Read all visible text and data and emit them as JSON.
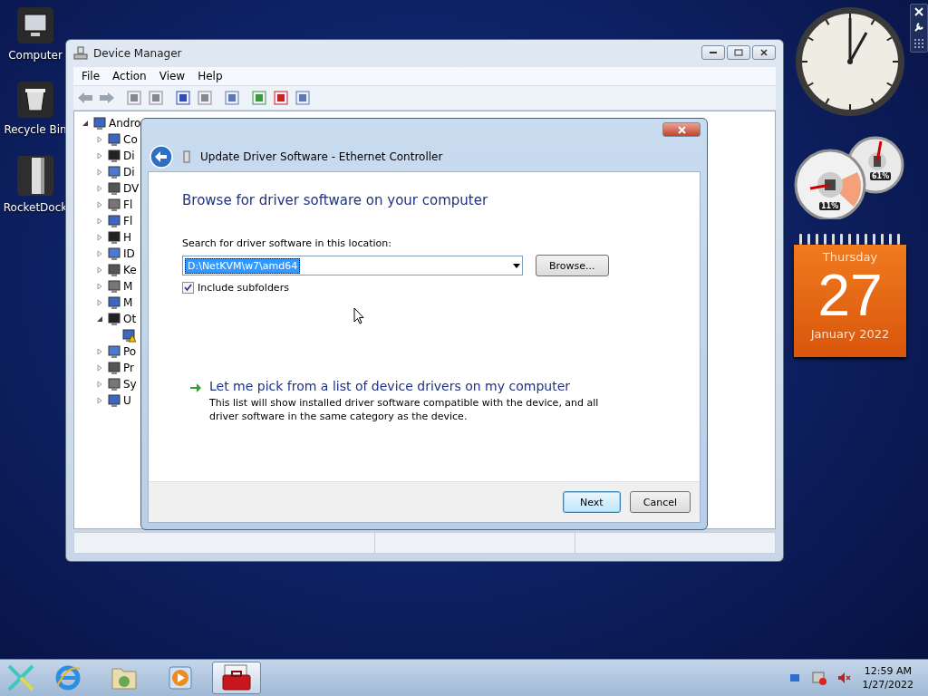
{
  "desktop_icons": [
    {
      "label": "Computer",
      "kind": "computer"
    },
    {
      "label": "Recycle Bin",
      "kind": "bin"
    },
    {
      "label": "RocketDock",
      "kind": "dock"
    }
  ],
  "device_manager": {
    "title": "Device Manager",
    "menu": [
      "File",
      "Action",
      "View",
      "Help"
    ],
    "tree": {
      "label": "Andro",
      "expanded": true,
      "warning": false,
      "children": [
        {
          "label": "Co",
          "expanded": false,
          "warning": false
        },
        {
          "label": "Di",
          "expanded": false,
          "warning": false
        },
        {
          "label": "Di",
          "expanded": false,
          "warning": false
        },
        {
          "label": "DV",
          "expanded": false,
          "warning": false
        },
        {
          "label": "Fl",
          "expanded": false,
          "warning": false
        },
        {
          "label": "Fl",
          "expanded": false,
          "warning": false
        },
        {
          "label": "H",
          "expanded": false,
          "warning": false
        },
        {
          "label": "ID",
          "expanded": false,
          "warning": false
        },
        {
          "label": "Ke",
          "expanded": false,
          "warning": false
        },
        {
          "label": "M",
          "expanded": false,
          "warning": false
        },
        {
          "label": "M",
          "expanded": false,
          "warning": false
        },
        {
          "label": "Ot",
          "expanded": true,
          "warning": false,
          "children": [
            {
              "warning": true
            }
          ]
        },
        {
          "label": "Po",
          "expanded": false,
          "warning": false
        },
        {
          "label": "Pr",
          "expanded": false,
          "warning": false
        },
        {
          "label": "Sy",
          "expanded": false,
          "warning": false
        },
        {
          "label": "U",
          "expanded": false,
          "warning": false
        }
      ]
    }
  },
  "dialog": {
    "title": "Update Driver Software - Ethernet Controller",
    "heading": "Browse for driver software on your computer",
    "location_label": "Search for driver software in this location:",
    "location_value": "D:\\NetKVM\\w7\\amd64",
    "browse": "Browse...",
    "include_subfolders": {
      "label": "Include subfolders",
      "checked": true
    },
    "pick_link": {
      "label": "Let me pick from a list of device drivers on my computer",
      "description": "This list will show installed driver software compatible with the device, and all driver software in the same category as the device."
    },
    "buttons": [
      {
        "label": "Next",
        "default": true
      },
      {
        "label": "Cancel",
        "default": false
      }
    ]
  },
  "gadgets": {
    "cpu_reading": "11%",
    "memory_reading": "61%",
    "calendar": {
      "weekday": "Thursday",
      "day": "27",
      "month": "January 2022"
    }
  },
  "taskbar": {
    "items": [
      {
        "kind": "ie",
        "active": false
      },
      {
        "kind": "folder",
        "active": false
      },
      {
        "kind": "media",
        "active": false
      },
      {
        "kind": "toolbox",
        "active": true
      }
    ],
    "time": "12:59 AM",
    "date": "1/27/2022"
  }
}
